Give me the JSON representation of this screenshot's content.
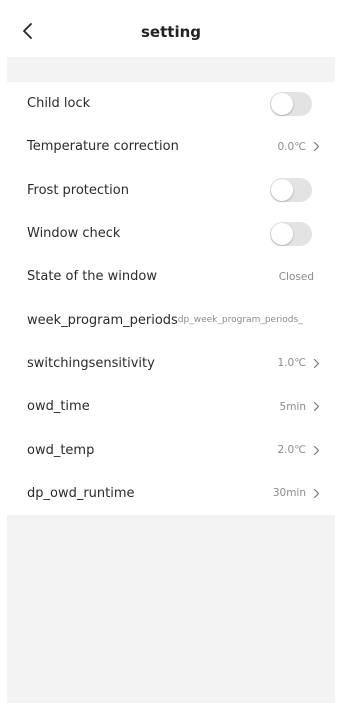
{
  "header": {
    "title": "setting",
    "back_icon": "chevron-left-icon"
  },
  "settings": [
    {
      "label": "Child lock",
      "type": "toggle",
      "on": false
    },
    {
      "label": "Temperature correction",
      "type": "value",
      "value": "0.0℃",
      "chevron": true
    },
    {
      "label": "Frost protection",
      "type": "toggle",
      "on": false
    },
    {
      "label": "Window check",
      "type": "toggle",
      "on": false
    },
    {
      "label": "State of the window",
      "type": "value",
      "value": "Closed",
      "chevron": false
    },
    {
      "label": "week_program_periods",
      "type": "value",
      "value": "dp_week_program_periods_",
      "chevron": false
    },
    {
      "label": "switchingsensitivity",
      "type": "value",
      "value": "1.0℃",
      "chevron": true
    },
    {
      "label": "owd_time",
      "type": "value",
      "value": "5min",
      "chevron": true
    },
    {
      "label": "owd_temp",
      "type": "value",
      "value": "2.0℃",
      "chevron": true
    },
    {
      "label": "dp_owd_runtime",
      "type": "value",
      "value": "30min",
      "chevron": true
    }
  ],
  "colors": {
    "background": "#f3f3f3",
    "surface": "#ffffff",
    "toggle_off": "#e3e3e3",
    "secondary_text": "#8a8a8a"
  }
}
